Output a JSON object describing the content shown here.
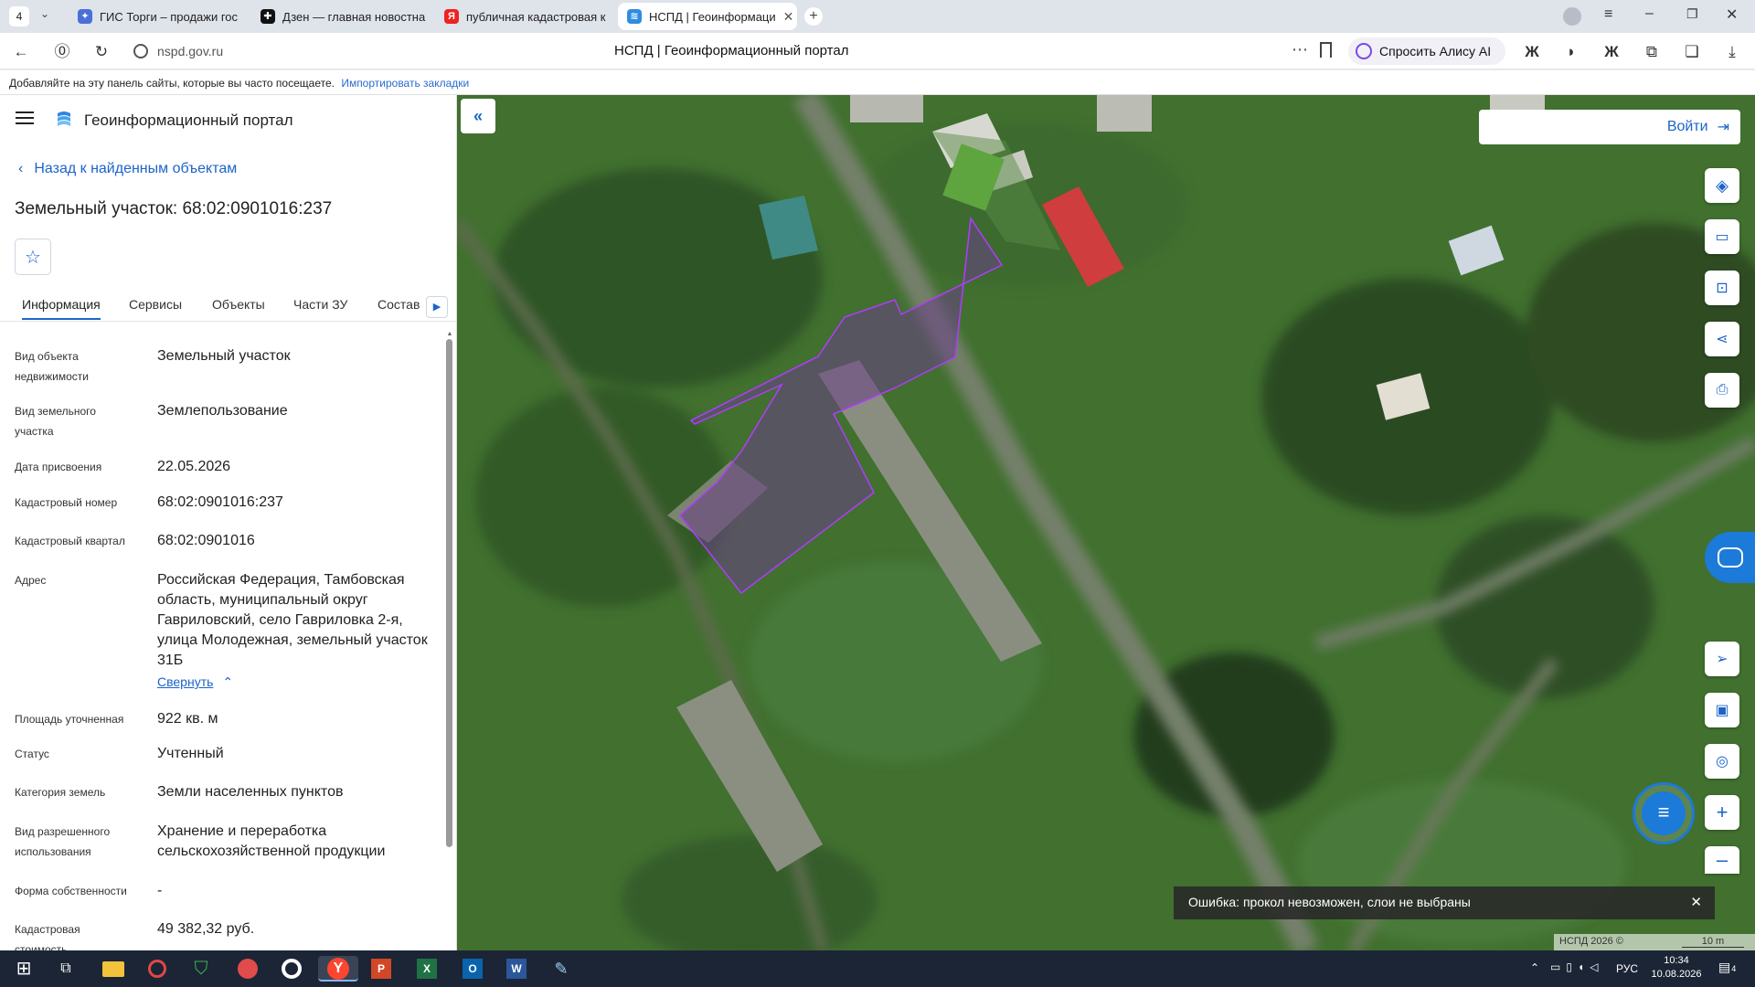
{
  "browser": {
    "tab_count": "4",
    "tabs": [
      {
        "label": "ГИС Торги – продажи гос"
      },
      {
        "label": "Дзен — главная новостна"
      },
      {
        "label": "публичная кадастровая к"
      },
      {
        "label": "НСПД | Геоинформаци"
      }
    ],
    "url": "nspd.gov.ru",
    "page_title": "НСПД | Геоинформационный портал",
    "alice_label": "Спросить Алису AI",
    "bookmarks_text": "Добавляйте на эту панель сайты, которые вы часто посещаете.",
    "import_link": "Импортировать закладки"
  },
  "portal": {
    "title": "Геоинформационный портал",
    "back_link": "Назад к найденным объектам",
    "object_title": "Земельный участок: 68:02:0901016:237",
    "tabs": [
      "Информация",
      "Сервисы",
      "Объекты",
      "Части ЗУ",
      "Состав"
    ],
    "fields": [
      {
        "label": "Вид объекта недвижимости",
        "value": "Земельный участок"
      },
      {
        "label": "Вид земельного участка",
        "value": "Землепользование"
      },
      {
        "label": "Дата присвоения",
        "value": "22.05.2026"
      },
      {
        "label": "Кадастровый номер",
        "value": "68:02:0901016:237"
      },
      {
        "label": "Кадастровый квартал",
        "value": "68:02:0901016"
      },
      {
        "label": "Адрес",
        "value": "Российская Федерация, Тамбовская область, муниципальный округ Гавриловский, село Гавриловка 2-я, улица Молодежная, земельный участок 31Б"
      },
      {
        "label": "Площадь уточненная",
        "value": "922 кв. м"
      },
      {
        "label": "Статус",
        "value": "Учтенный"
      },
      {
        "label": "Категория земель",
        "value": "Земли населенных пунктов"
      },
      {
        "label": "Вид разрешенного использования",
        "value": "Хранение и переработка сельскохозяйственной продукции"
      },
      {
        "label": "Форма собственности",
        "value": "-"
      },
      {
        "label": "Кадастровая стоимость",
        "value": "49 382,32 руб."
      }
    ],
    "collapse_link": "Свернуть"
  },
  "map": {
    "login_label": "Войти",
    "error_message": "Ошибка: прокол невозможен, слои не выбраны",
    "attribution": "НСПД 2026 ©",
    "scale_label": "10 m",
    "parcel_color": "#b03cff"
  },
  "taskbar": {
    "time": "10:34",
    "date": "10.08.2026",
    "lang": "РУС",
    "notifications": "4"
  }
}
